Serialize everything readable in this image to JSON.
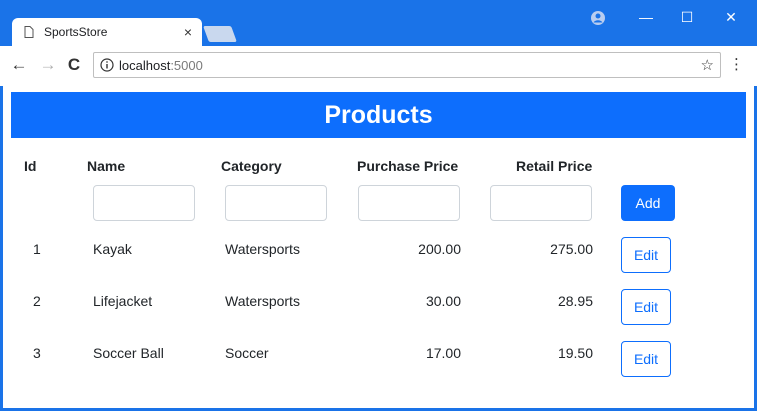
{
  "browser": {
    "tab_title": "SportsStore",
    "tab_close": "×",
    "url_host": "localhost",
    "url_port": ":5000",
    "window_minimize": "—",
    "window_maximize": "☐",
    "window_close": "✕",
    "back": "←",
    "forward": "→",
    "reload": "C",
    "star": "☆",
    "menu": "⋮"
  },
  "page": {
    "title": "Products",
    "columns": [
      "Id",
      "Name",
      "Category",
      "Purchase Price",
      "Retail Price"
    ],
    "add_label": "Add",
    "edit_label": "Edit",
    "rows": [
      {
        "id": "1",
        "name": "Kayak",
        "category": "Watersports",
        "purchase": "200.00",
        "retail": "275.00"
      },
      {
        "id": "2",
        "name": "Lifejacket",
        "category": "Watersports",
        "purchase": "30.00",
        "retail": "28.95"
      },
      {
        "id": "3",
        "name": "Soccer Ball",
        "category": "Soccer",
        "purchase": "17.00",
        "retail": "19.50"
      }
    ]
  },
  "colors": {
    "chrome": "#1a73e8",
    "primary": "#0d6efd"
  }
}
